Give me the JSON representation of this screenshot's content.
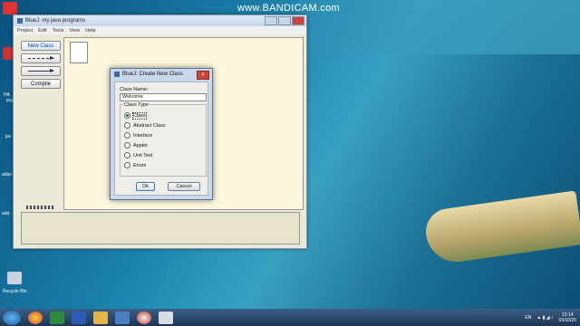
{
  "watermark": "www.BANDICAM.com",
  "desktop": {
    "labels": [
      "HA",
      "PH",
      "jav",
      "adas",
      "ada",
      "Recycle Bin"
    ]
  },
  "bluej": {
    "title": "BlueJ:  my java programs",
    "menu": [
      "Project",
      "Edit",
      "Tools",
      "View",
      "Help"
    ],
    "toolbar": {
      "new_class": "New Class",
      "compile": "Compile"
    }
  },
  "dialog": {
    "title": "BlueJ:  Create New Class",
    "class_name_label": "Class Name:",
    "class_name_value": "Welcome",
    "class_type_label": "Class Type",
    "options": [
      "Class",
      "Abstract Class",
      "Interface",
      "Applet",
      "Unit Test",
      "Enum"
    ],
    "selected_index": 0,
    "ok": "Ok",
    "cancel": "Cancel"
  },
  "taskbar": {
    "lang": "EN",
    "time": "13:14",
    "date": "03/10/20"
  },
  "colors": {
    "accent": "#3a79c6",
    "canvas": "#fbf6dc"
  }
}
